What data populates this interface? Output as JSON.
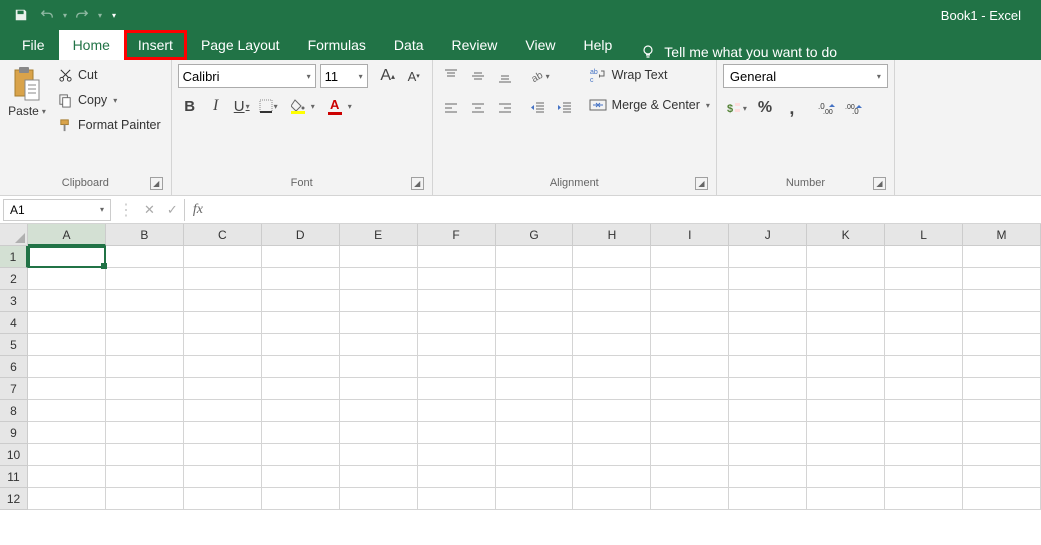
{
  "titlebar": {
    "title": "Book1  -  Excel"
  },
  "tabs": {
    "file": "File",
    "home": "Home",
    "insert": "Insert",
    "page_layout": "Page Layout",
    "formulas": "Formulas",
    "data": "Data",
    "review": "Review",
    "view": "View",
    "help": "Help",
    "tell_me": "Tell me what you want to do"
  },
  "ribbon": {
    "clipboard": {
      "label": "Clipboard",
      "paste": "Paste",
      "cut": "Cut",
      "copy": "Copy",
      "format_painter": "Format Painter"
    },
    "font": {
      "label": "Font",
      "name": "Calibri",
      "size": "11",
      "bold": "B",
      "italic": "I",
      "underline": "U"
    },
    "alignment": {
      "label": "Alignment",
      "wrap_text": "Wrap Text",
      "merge_center": "Merge & Center"
    },
    "number": {
      "label": "Number",
      "format": "General",
      "percent": "%",
      "comma": ","
    }
  },
  "formula_bar": {
    "name_box": "A1",
    "fx": "fx"
  },
  "grid": {
    "columns": [
      "A",
      "B",
      "C",
      "D",
      "E",
      "F",
      "G",
      "H",
      "I",
      "J",
      "K",
      "L",
      "M"
    ],
    "rows": [
      "1",
      "2",
      "3",
      "4",
      "5",
      "6",
      "7",
      "8",
      "9",
      "10",
      "11",
      "12"
    ],
    "selected": "A1"
  }
}
